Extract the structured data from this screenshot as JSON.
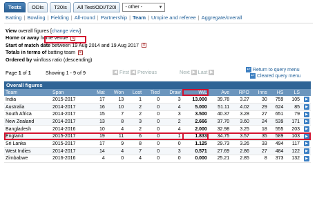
{
  "tabs": [
    {
      "label": "Tests",
      "active": true
    },
    {
      "label": "ODIs",
      "active": false
    },
    {
      "label": "T20Is",
      "active": false
    },
    {
      "label": "All Test/ODI/T20I",
      "active": false
    }
  ],
  "other_select": "- other -",
  "subnav": [
    {
      "label": "Batting",
      "selected": false
    },
    {
      "label": "Bowling",
      "selected": false
    },
    {
      "label": "Fielding",
      "selected": false
    },
    {
      "label": "All-round",
      "selected": false
    },
    {
      "label": "Partnership",
      "selected": false
    },
    {
      "label": "Team",
      "selected": true
    },
    {
      "label": "Umpire and referee",
      "selected": false
    },
    {
      "label": "Aggregate/overall",
      "selected": false
    }
  ],
  "query": {
    "view_label": "View",
    "view_value": "overall figures",
    "change_view": "change view",
    "home_label": "Home or away",
    "home_value": "home venue",
    "start_label": "Start of match date",
    "start_value": "between 19 Aug 2014 and 19 Aug 2017",
    "totals_label": "Totals in terms of",
    "totals_value": "batting team",
    "ordered_label": "Ordered by",
    "ordered_value": "win/loss ratio (descending)"
  },
  "pager": {
    "page_prefix": "Page",
    "page": "1",
    "of": "of",
    "total_pages": "1",
    "showing": "Showing 1 - 9 of 9",
    "first": "First",
    "previous": "Previous",
    "next": "Next",
    "last": "Last"
  },
  "links": {
    "return": "Return to query menu",
    "cleared": "Cleared query menu"
  },
  "table": {
    "title": "Overall figures",
    "headers": [
      "Team",
      "Span",
      "Mat",
      "Won",
      "Lost",
      "Tied",
      "Draw",
      "W/L",
      "Ave",
      "RPO",
      "Inns",
      "HS",
      "LS"
    ],
    "rows": [
      [
        "India",
        "2015-2017",
        "17",
        "13",
        "1",
        "0",
        "3",
        "13.000",
        "39.78",
        "3.27",
        "30",
        "759",
        "105"
      ],
      [
        "Australia",
        "2014-2017",
        "16",
        "10",
        "2",
        "0",
        "4",
        "5.000",
        "51.11",
        "4.02",
        "29",
        "624",
        "85"
      ],
      [
        "South Africa",
        "2014-2017",
        "15",
        "7",
        "2",
        "0",
        "3",
        "3.500",
        "40.37",
        "3.28",
        "27",
        "651",
        "79"
      ],
      [
        "New Zealand",
        "2014-2017",
        "13",
        "8",
        "3",
        "0",
        "2",
        "2.666",
        "37.70",
        "3.60",
        "24",
        "539",
        "171"
      ],
      [
        "Bangladesh",
        "2014-2016",
        "10",
        "4",
        "2",
        "0",
        "4",
        "2.000",
        "32.98",
        "3.25",
        "18",
        "555",
        "203"
      ],
      [
        "England",
        "2015-2017",
        "19",
        "11",
        "6",
        "0",
        "1",
        "1.833",
        "34.75",
        "3.57",
        "35",
        "589",
        "103"
      ],
      [
        "Sri Lanka",
        "2015-2017",
        "17",
        "9",
        "8",
        "0",
        "0",
        "1.125",
        "29.73",
        "3.26",
        "33",
        "494",
        "117"
      ],
      [
        "West Indies",
        "2014-2017",
        "14",
        "4",
        "7",
        "0",
        "3",
        "0.571",
        "27.69",
        "2.86",
        "27",
        "484",
        "122"
      ],
      [
        "Zimbabwe",
        "2016-2016",
        "4",
        "0",
        "4",
        "0",
        "0",
        "0.000",
        "25.21",
        "2.85",
        "8",
        "373",
        "132"
      ]
    ]
  }
}
